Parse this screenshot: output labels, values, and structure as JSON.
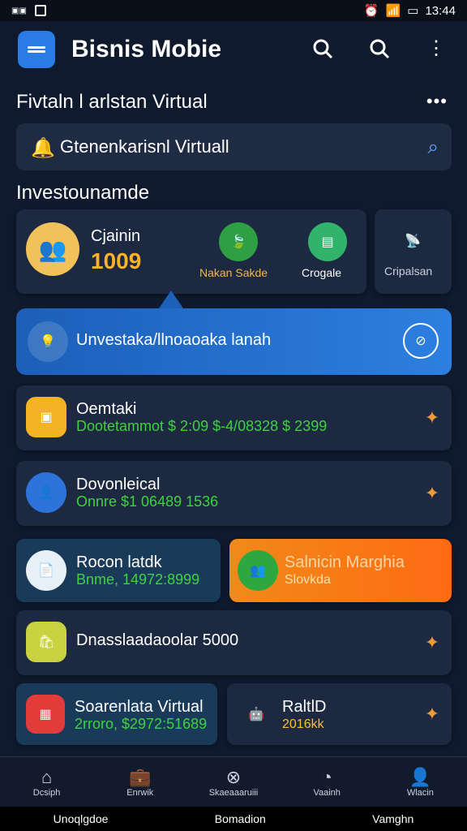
{
  "status": {
    "left_icon": "sim-icon",
    "left_box": "square-icon",
    "time": "13:44",
    "alarm": "alarm-icon",
    "wifi": "wifi-icon",
    "signal": "signal-icon",
    "battery": "battery-icon"
  },
  "app": {
    "title": "Bisnis Mobie",
    "logo_icon": "menu-icon",
    "actions": [
      "search-icon",
      "search-icon",
      "more-vertical-icon"
    ]
  },
  "section1": {
    "title": "Fivtaln l arlstan Virtual",
    "more": "•••"
  },
  "search": {
    "text": "Gtenenkarisnl Virtuall",
    "left_icon": "bell-icon",
    "right_icon": "search-icon"
  },
  "section2": {
    "title": "Investounamde"
  },
  "summary": {
    "label": "Cjainin",
    "value": "1009",
    "action1": "Nakan Sakde",
    "action2": "Crogale",
    "side_label": "Cripalsan"
  },
  "promo": {
    "text": "Unvestaka/llnoaoaka lanah",
    "left_icon": "lightbulb-icon",
    "right_icon": "compass-icon"
  },
  "rows": [
    {
      "title": "Oemtaki",
      "detail": "Dootetammot $ 2:09 $-4/08328 $ 2399"
    },
    {
      "title": "Dovonleical",
      "detail": "Onnre $1 06489 1536"
    }
  ],
  "split1": {
    "left": {
      "title": "Rocon latdk",
      "detail": "Bnme, 14972:8999"
    },
    "right": {
      "title": "Salnicin Marghia",
      "detail": "Slovkda"
    }
  },
  "row3": {
    "title": "Dnasslaadaoolar 5000"
  },
  "split2": {
    "left": {
      "title": "Soarenlata Virtual",
      "detail": "2rroro, $2972:51689"
    },
    "right": {
      "title": "RaltlD",
      "detail": "2016kk"
    }
  },
  "bottom_nav": [
    {
      "icon": "home-icon",
      "label": "Dcsiph"
    },
    {
      "icon": "briefcase-icon",
      "label": "Enrwik"
    },
    {
      "icon": "cancel-circle-icon",
      "label": "Skaeaaaruiii"
    },
    {
      "icon": "timer-icon",
      "label": "Vaainh"
    },
    {
      "icon": "user-icon",
      "label": "Wlacin"
    }
  ],
  "bottom_strip": [
    "Unoqlgdoe",
    "Bomadion",
    "Vamghn"
  ],
  "colors": {
    "accent": "#2b7be4",
    "orange": "#f7b32b",
    "green": "#3ed23e"
  }
}
